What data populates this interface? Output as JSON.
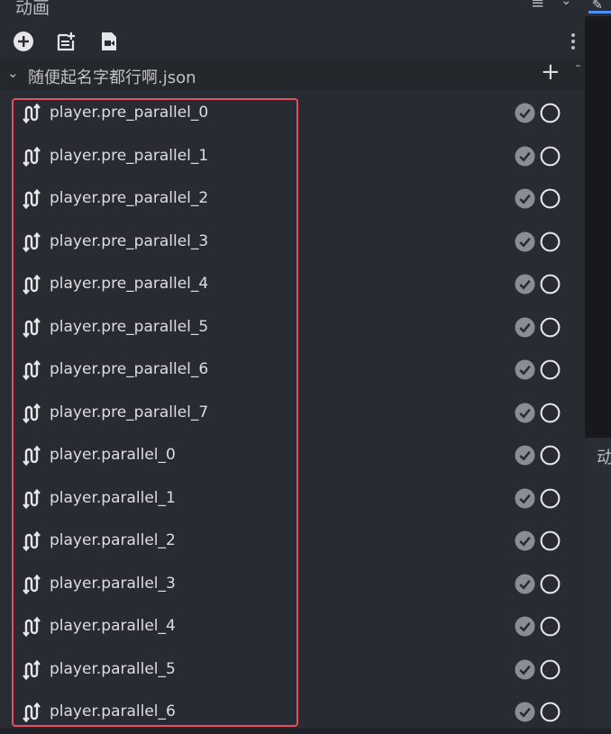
{
  "panel": {
    "title": "动画"
  },
  "header_icons": {
    "menu": "menu-icon",
    "chevron": "chevron-down-icon"
  },
  "toolbar": {
    "icons": [
      "add-circle-icon",
      "new-document-icon",
      "video-file-icon",
      "more-vertical-icon"
    ]
  },
  "section": {
    "name": "随便起名字都行啊.json"
  },
  "side_panel": {
    "label": "动"
  },
  "colors": {
    "highlight": "#e3505f",
    "accent": "#4e8ef2",
    "check_fill": "#8a8d92"
  },
  "animations": [
    {
      "label": "player.pre_parallel_0"
    },
    {
      "label": "player.pre_parallel_1"
    },
    {
      "label": "player.pre_parallel_2"
    },
    {
      "label": "player.pre_parallel_3"
    },
    {
      "label": "player.pre_parallel_4"
    },
    {
      "label": "player.pre_parallel_5"
    },
    {
      "label": "player.pre_parallel_6"
    },
    {
      "label": "player.pre_parallel_7"
    },
    {
      "label": "player.parallel_0"
    },
    {
      "label": "player.parallel_1"
    },
    {
      "label": "player.parallel_2"
    },
    {
      "label": "player.parallel_3"
    },
    {
      "label": "player.parallel_4"
    },
    {
      "label": "player.parallel_5"
    },
    {
      "label": "player.parallel_6"
    }
  ]
}
